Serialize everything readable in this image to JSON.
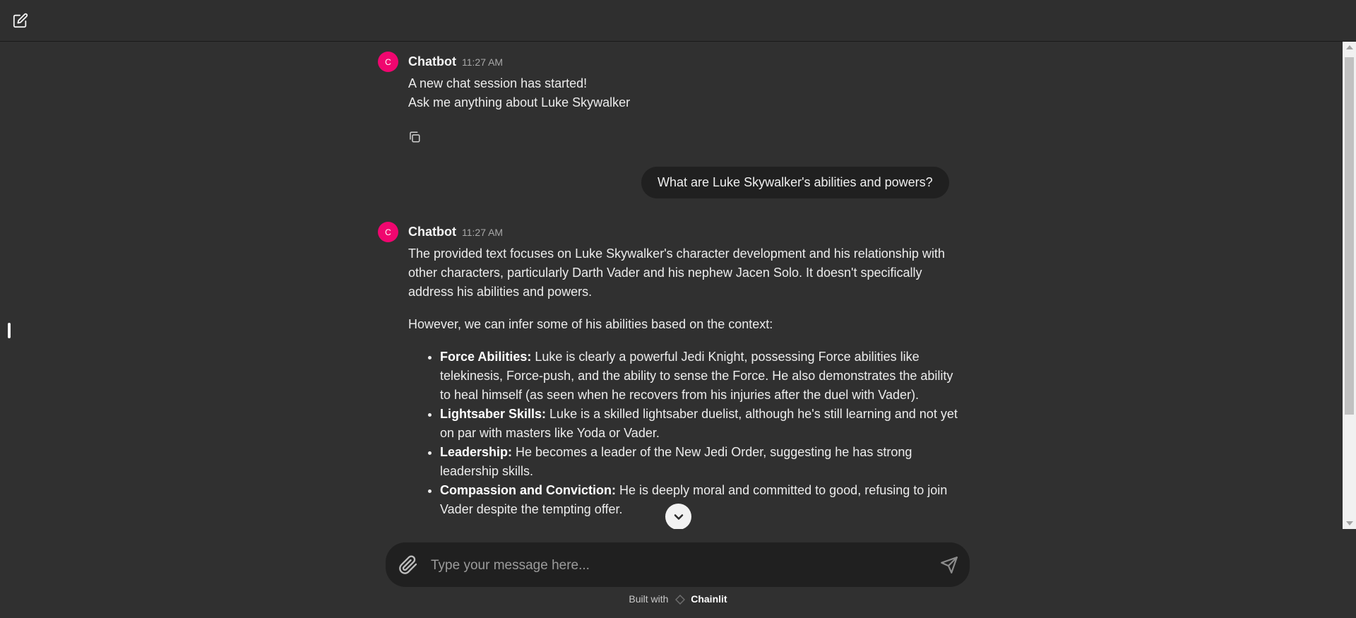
{
  "header": {
    "new_chat_icon": "edit-square-icon"
  },
  "messages": [
    {
      "author": "Chatbot",
      "avatar_letter": "C",
      "time": "11:27 AM",
      "lines": [
        "A new chat session has started!",
        "Ask me anything about Luke Skywalker"
      ],
      "copy_icon": "copy-icon"
    },
    {
      "author": "Chatbot",
      "avatar_letter": "C",
      "time": "11:27 AM",
      "paragraphs": [
        "The provided text focuses on Luke Skywalker's character development and his relationship with other characters, particularly Darth Vader and his nephew Jacen Solo. It doesn't specifically address his abilities and powers.",
        "However, we can infer some of his abilities based on the context:"
      ],
      "bullets": [
        {
          "title": "Force Abilities:",
          "text": " Luke is clearly a powerful Jedi Knight, possessing Force abilities like telekinesis, Force-push, and the ability to sense the Force. He also demonstrates the ability to heal himself (as seen when he recovers from his injuries after the duel with Vader)."
        },
        {
          "title": "Lightsaber Skills:",
          "text": " Luke is a skilled lightsaber duelist, although he's still learning and not yet on par with masters like Yoda or Vader."
        },
        {
          "title": "Leadership:",
          "text": " He becomes a leader of the New Jedi Order, suggesting he has strong leadership skills."
        },
        {
          "title": "Compassion and Conviction:",
          "text": " He is deeply moral and committed to good, refusing to join Vader despite the tempting offer."
        }
      ]
    }
  ],
  "user_message": "What are Luke Skywalker's abilities and powers?",
  "composer": {
    "placeholder": "Type your message here...",
    "value": ""
  },
  "footer": {
    "built_with": "Built with",
    "brand": "Chainlit"
  },
  "colors": {
    "accent": "#f0066f",
    "background": "#303030",
    "bubble": "#202020"
  }
}
